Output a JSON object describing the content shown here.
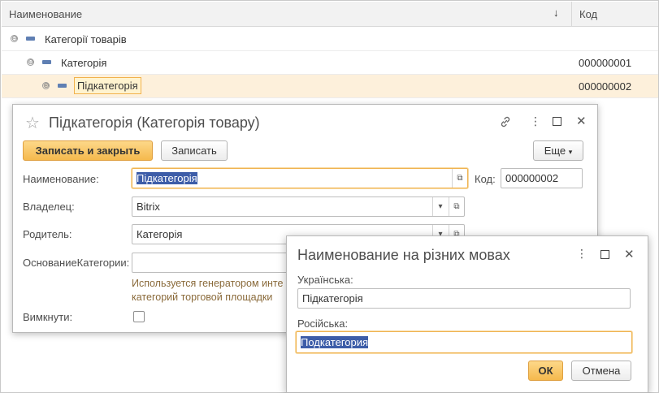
{
  "list": {
    "columns": {
      "name": "Наименование",
      "sort_indicator": "↓",
      "code": "Код"
    },
    "rows": [
      {
        "name": "Категорії товарів",
        "code": ""
      },
      {
        "name": "Категорія",
        "code": "000000001"
      },
      {
        "name": "Підкатегорія",
        "code": "000000002"
      }
    ]
  },
  "form": {
    "title": "Підкатегорія (Категорія товару)",
    "toolbar": {
      "save_close": "Записать и закрыть",
      "save": "Записать",
      "more": "Еще"
    },
    "fields": {
      "name_label": "Наименование:",
      "name_value": "Підкатегорія",
      "code_label": "Код:",
      "code_value": "000000002",
      "owner_label": "Владелец:",
      "owner_value": "Bitrix",
      "parent_label": "Родитель:",
      "parent_value": "Категорія",
      "basis_label": "ОснованиеКатегории:",
      "basis_value": "",
      "basis_hint_line1": "Используется генератором инте",
      "basis_hint_line2": "категорий торговой площадки",
      "disable_label": "Вимкнути:"
    }
  },
  "dialog": {
    "title": "Наименование на різних мовах",
    "ukrainian_label": "Українська:",
    "ukrainian_value": "Підкатегорія",
    "russian_label": "Російська:",
    "russian_value": "Подкатегория",
    "ok": "ОК",
    "cancel": "Отмена"
  },
  "icons": {
    "star": "☆",
    "link": "🔗",
    "more_vert": "⋮",
    "maximize": "☐",
    "close": "✕",
    "dropdown": "▾",
    "open": "⧉",
    "expand_minus": "⊖",
    "expand_plus": "⊕"
  },
  "colors": {
    "accent": "#f5b94d",
    "selection": "#3d5da8",
    "row_selected": "#fdf0db"
  }
}
